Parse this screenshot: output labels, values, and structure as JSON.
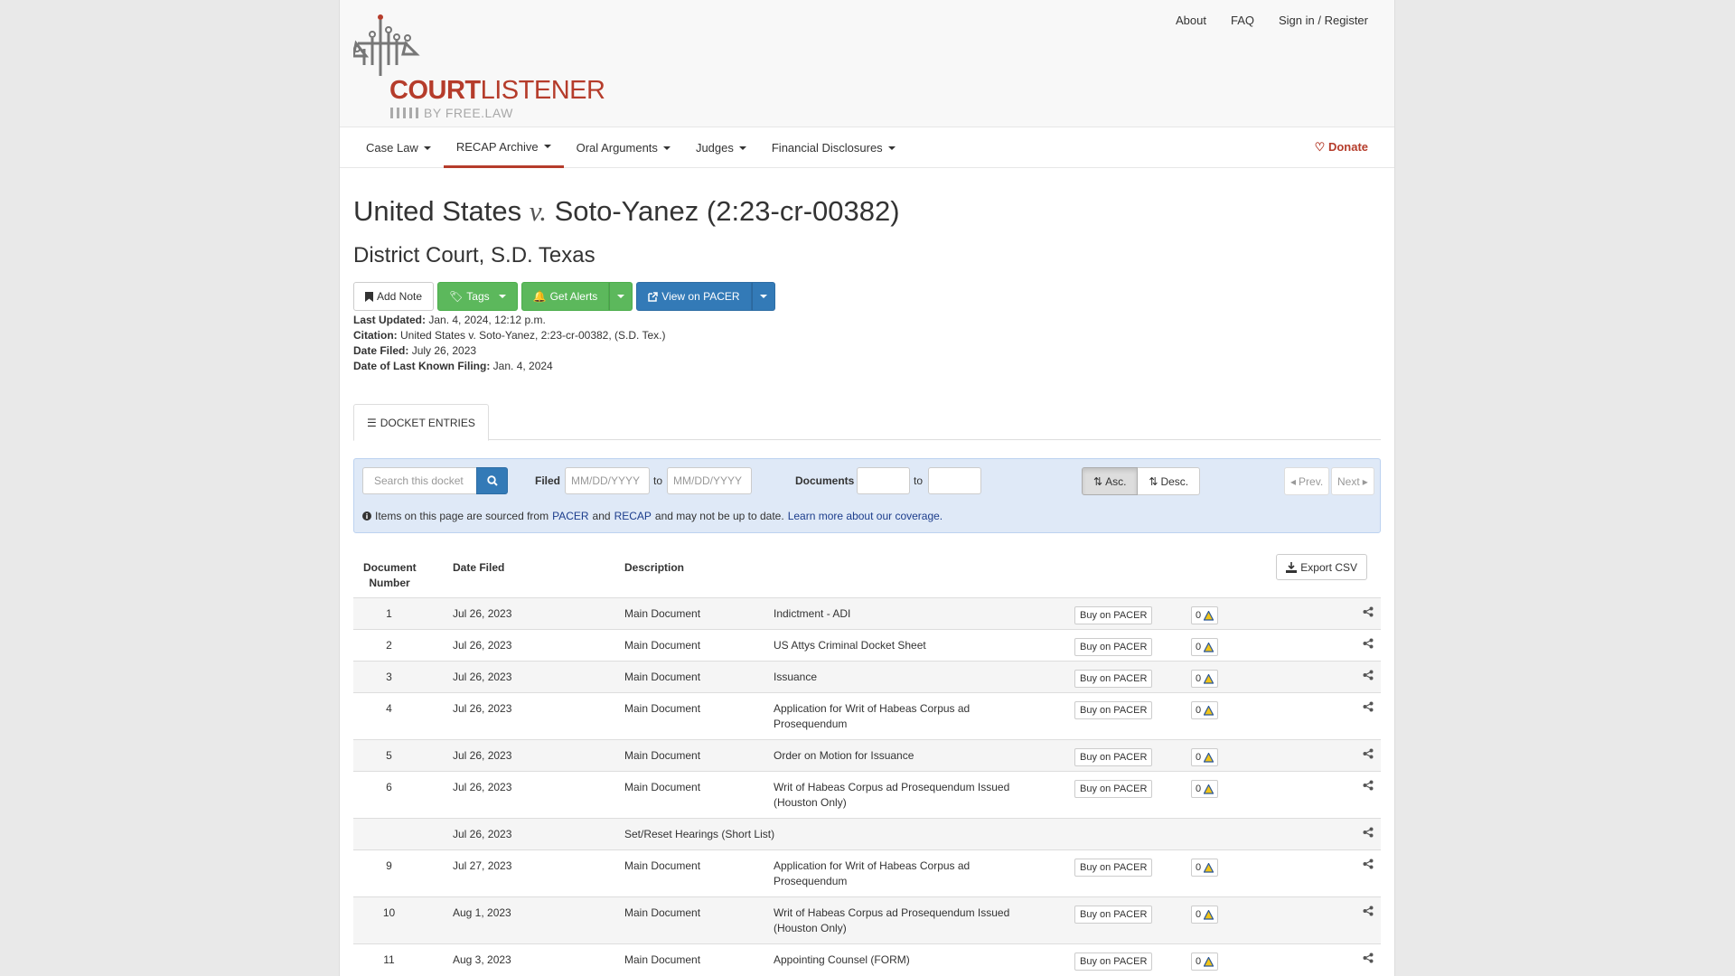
{
  "header": {
    "logo_main_bold": "COURT",
    "logo_main_light": "LISTENER",
    "logo_sub": "BY FREE.LAW",
    "top_links": [
      "About",
      "FAQ",
      "Sign in / Register"
    ]
  },
  "nav": {
    "items": [
      "Case Law",
      "RECAP Archive",
      "Oral Arguments",
      "Judges",
      "Financial Disclosures"
    ],
    "active": "RECAP Archive",
    "donate": "Donate"
  },
  "case": {
    "title_left": "United States",
    "title_v": "v.",
    "title_right": "Soto-Yanez (2:23-cr-00382)",
    "court": "District Court, S.D. Texas"
  },
  "actions": {
    "add_note": "Add Note",
    "tags": "Tags",
    "get_alerts": "Get Alerts",
    "view_pacer": "View on PACER"
  },
  "meta": {
    "last_updated_label": "Last Updated:",
    "last_updated": "Jan. 4, 2024, 12:12 p.m.",
    "citation_label": "Citation:",
    "citation": "United States v. Soto-Yanez, 2:23-cr-00382, (S.D. Tex.)",
    "date_filed_label": "Date Filed:",
    "date_filed": "July 26, 2023",
    "last_filing_label": "Date of Last Known Filing:",
    "last_filing": "Jan. 4, 2024"
  },
  "tab": {
    "label": "DOCKET ENTRIES"
  },
  "filters": {
    "search_placeholder": "Search this docket",
    "filed_label": "Filed",
    "date_placeholder": "MM/DD/YYYY",
    "to": "to",
    "documents_label": "Documents",
    "asc": "Asc.",
    "desc": "Desc.",
    "prev": "Prev.",
    "next": "Next",
    "info_prefix": "Items on this page are sourced from",
    "pacer": "PACER",
    "and": "and",
    "recap": "RECAP",
    "info_suffix": "and may not be up to date.",
    "learn_more": "Learn more about our coverage."
  },
  "table": {
    "col_docnum": "Document Number",
    "col_date": "Date Filed",
    "col_desc": "Description",
    "export": "Export CSV",
    "buy": "Buy on PACER",
    "count": "0",
    "rows": [
      {
        "num": "1",
        "date": "Jul 26, 2023",
        "type": "Main Document",
        "desc": "Indictment - ADI"
      },
      {
        "num": "2",
        "date": "Jul 26, 2023",
        "type": "Main Document",
        "desc": "US Attys Criminal Docket Sheet"
      },
      {
        "num": "3",
        "date": "Jul 26, 2023",
        "type": "Main Document",
        "desc": "Issuance"
      },
      {
        "num": "4",
        "date": "Jul 26, 2023",
        "type": "Main Document",
        "desc": "Application for Writ of Habeas Corpus ad Prosequendum"
      },
      {
        "num": "5",
        "date": "Jul 26, 2023",
        "type": "Main Document",
        "desc": "Order on Motion for Issuance"
      },
      {
        "num": "6",
        "date": "Jul 26, 2023",
        "type": "Main Document",
        "desc": "Writ of Habeas Corpus ad Prosequendum Issued (Houston Only)"
      },
      {
        "num": "",
        "date": "Jul 26, 2023",
        "type": "",
        "desc": "Set/Reset Hearings (Short List)"
      },
      {
        "num": "9",
        "date": "Jul 27, 2023",
        "type": "Main Document",
        "desc": "Application for Writ of Habeas Corpus ad Prosequendum"
      },
      {
        "num": "10",
        "date": "Aug 1, 2023",
        "type": "Main Document",
        "desc": "Writ of Habeas Corpus ad Prosequendum Issued (Houston Only)"
      },
      {
        "num": "11",
        "date": "Aug 3, 2023",
        "type": "Main Document",
        "desc": "Appointing Counsel (FORM)"
      }
    ]
  }
}
